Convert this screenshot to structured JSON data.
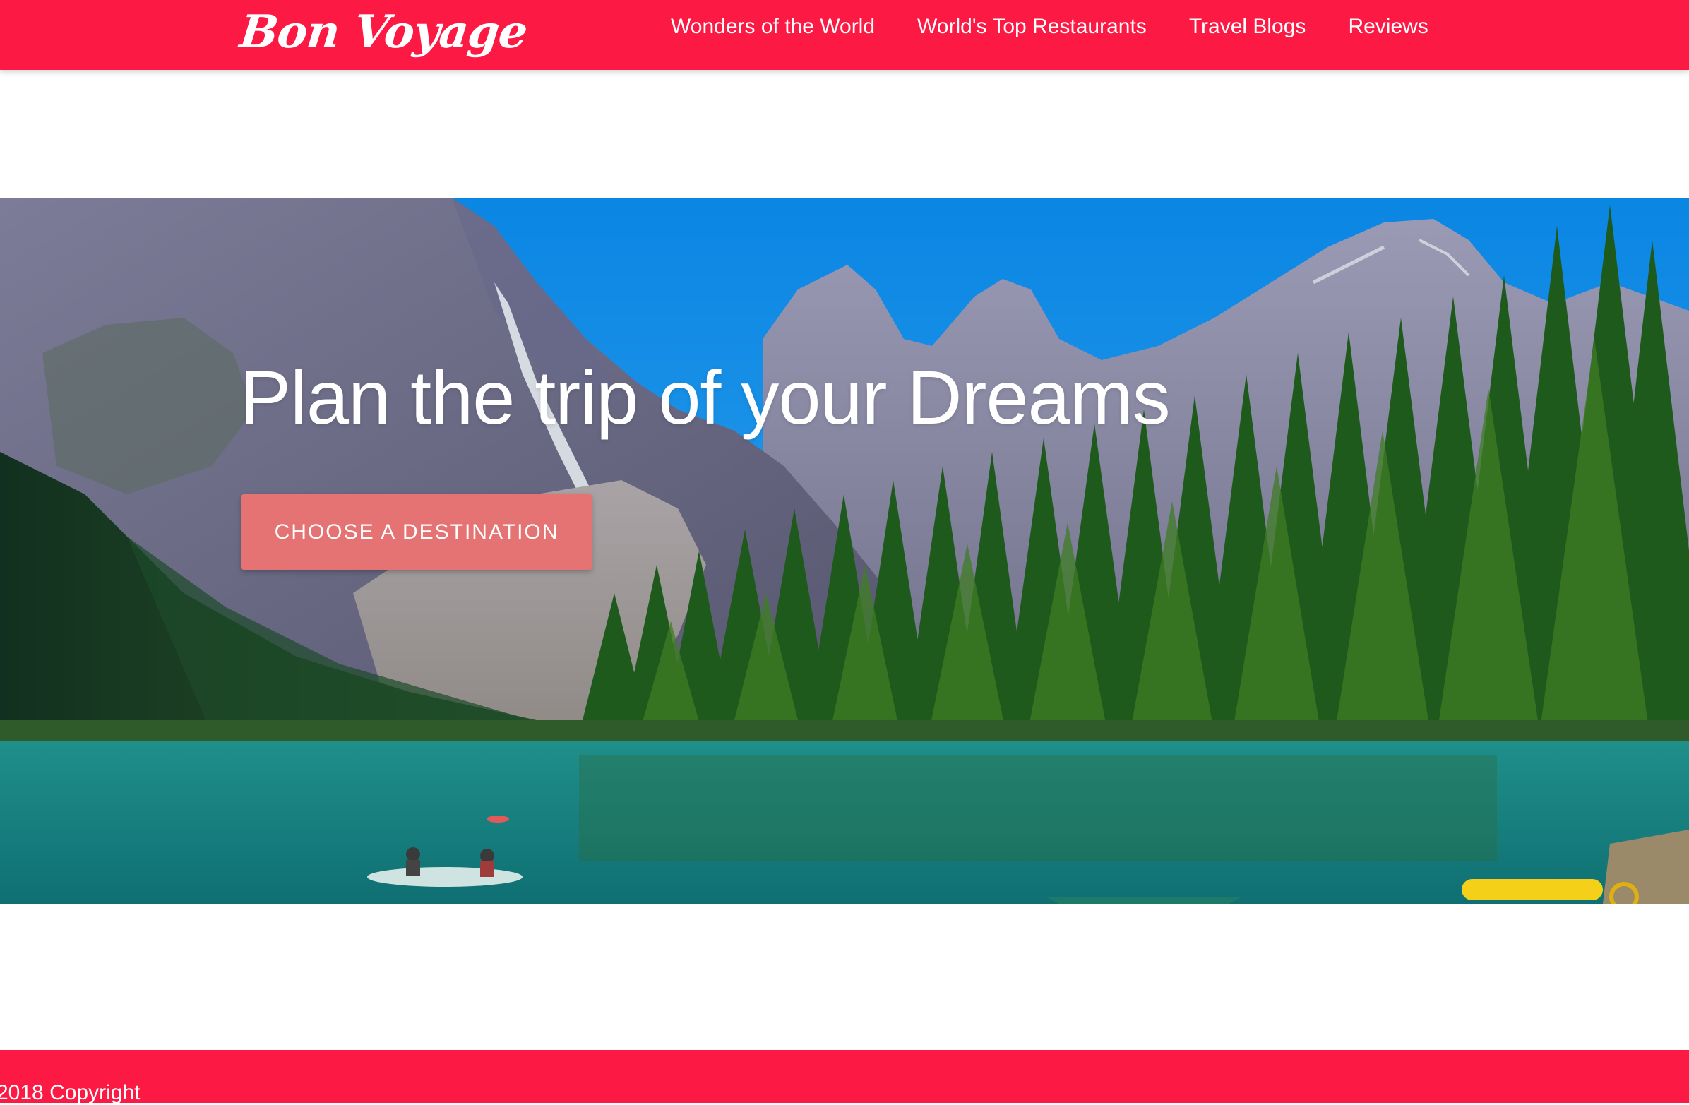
{
  "navbar": {
    "brand": "Bon Voyage",
    "links": [
      {
        "label": "Wonders of the World"
      },
      {
        "label": "World's Top Restaurants"
      },
      {
        "label": "Travel Blogs"
      },
      {
        "label": "Reviews"
      }
    ],
    "background_color": "#fc1a45"
  },
  "hero": {
    "title": "Plan the trip of your Dreams",
    "cta_label": "CHOOSE A DESTINATION",
    "cta_color": "#e57373",
    "image_subject": "mountain-lake-forest-photo"
  },
  "footer": {
    "text": "2018 Copyright",
    "background_color": "#fc1a45"
  }
}
